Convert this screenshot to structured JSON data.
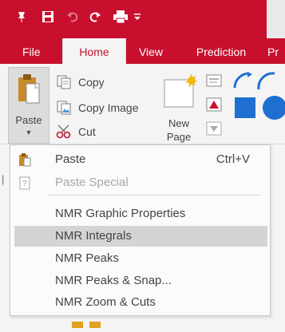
{
  "colors": {
    "brand": "#c8102e",
    "highlight": "#d4d4d4"
  },
  "quick_access": {
    "icons": [
      "pin-icon",
      "save-icon",
      "undo-icon",
      "redo-icon",
      "print-icon",
      "customize-icon"
    ]
  },
  "tabs": [
    {
      "label": "File",
      "active": false
    },
    {
      "label": "Home",
      "active": true
    },
    {
      "label": "View",
      "active": false
    },
    {
      "label": "Prediction",
      "active": false
    },
    {
      "label": "Pr",
      "active": false
    }
  ],
  "ribbon": {
    "paste_label": "Paste",
    "copy_label": "Copy",
    "copy_image_label": "Copy Image",
    "cut_label": "Cut",
    "new_page_line1": "New",
    "new_page_line2": "Page"
  },
  "paste_menu": {
    "items": [
      {
        "label": "Paste",
        "shortcut": "Ctrl+V",
        "disabled": false
      },
      {
        "label": "Paste Special",
        "shortcut": "",
        "disabled": true
      },
      {
        "label": "NMR Graphic Properties",
        "shortcut": "",
        "disabled": false
      },
      {
        "label": "NMR Integrals",
        "shortcut": "",
        "disabled": false,
        "highlighted": true
      },
      {
        "label": "NMR Peaks",
        "shortcut": "",
        "disabled": false
      },
      {
        "label": "NMR Peaks & Snap...",
        "shortcut": "",
        "disabled": false
      },
      {
        "label": "NMR Zoom & Cuts",
        "shortcut": "",
        "disabled": false
      }
    ]
  }
}
